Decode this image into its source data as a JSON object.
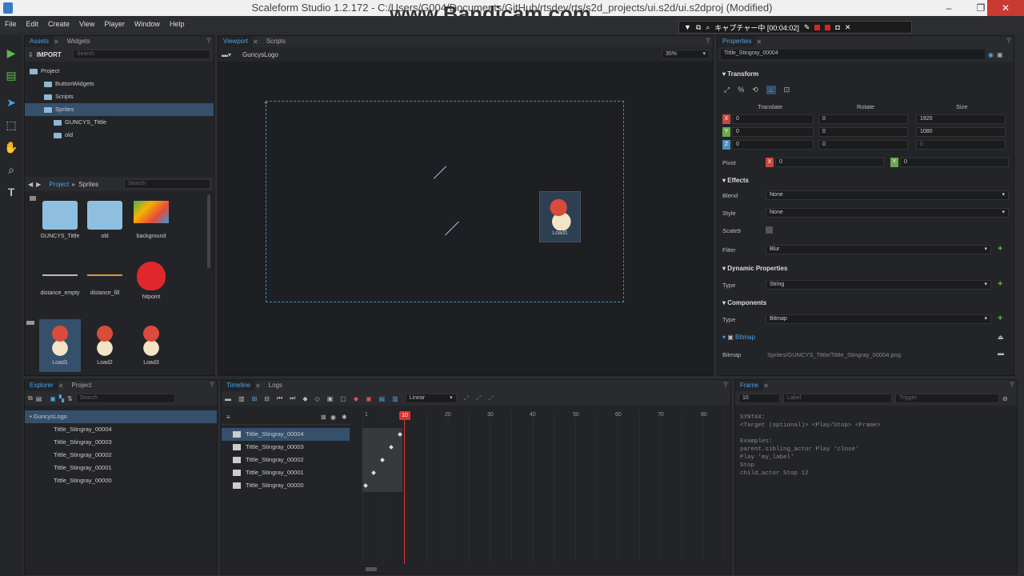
{
  "window": {
    "title": "Scaleform Studio 1.2.172 - C:/Users/G004/Documents/GitHub/rtsdev/rts/s2d_projects/ui.s2d/ui.s2dproj (Modified)"
  },
  "watermark": "www.Bandicam.com",
  "capture": {
    "label": "キャプチャー中 [00:04:02]"
  },
  "menu": [
    "File",
    "Edit",
    "Create",
    "View",
    "Player",
    "Window",
    "Help"
  ],
  "assets": {
    "tabs": [
      "Assets",
      "Widgets"
    ],
    "import_label": "IMPORT",
    "search_placeholder": "Search",
    "tree": [
      "Project",
      "ButtonWidgets",
      "Scripts",
      "Sprites",
      "GUNCYS_Tittle",
      "old"
    ],
    "breadcrumb": [
      "Project",
      "Sprites"
    ],
    "grid_search_placeholder": "Search",
    "items": [
      "GUNCYS_Tittle",
      "old",
      "background",
      "distance_empty",
      "distance_fill",
      "hitpoint",
      "Load1",
      "Load2",
      "Load3"
    ]
  },
  "viewport": {
    "tabs": [
      "Viewport",
      "Scripts"
    ],
    "scene": "GuncysLogo",
    "zoom": "35%",
    "sprite_label": "Load1"
  },
  "properties": {
    "tab": "Properties",
    "name": "Tittle_Stingray_00004",
    "transform_title": "Transform",
    "col_translate": "Translate",
    "col_rotate": "Rotate",
    "col_size": "Size",
    "axes": [
      "X",
      "Y",
      "Z"
    ],
    "translate": [
      "0",
      "0",
      "0"
    ],
    "rotate": [
      "0",
      "0",
      "0"
    ],
    "size": [
      "1920",
      "1080",
      "0"
    ],
    "pivot_label": "Pivot",
    "pivot_x": "0",
    "pivot_y": "0",
    "effects_title": "Effects",
    "blend_label": "Blend",
    "blend_value": "None",
    "style_label": "Style",
    "style_value": "None",
    "scale9_label": "Scale9",
    "filter_label": "Filter",
    "filter_value": "Blur",
    "dyn_title": "Dynamic Properties",
    "type_label": "Type",
    "dyn_type": "String",
    "components_title": "Components",
    "comp_type": "Bitmap",
    "bitmap_title": "Bitmap",
    "bitmap_label": "Bitmap",
    "bitmap_path": "Sprites/GUNCYS_Tittle/Tittle_Stingray_00004.png"
  },
  "explorer": {
    "tabs": [
      "Explorer",
      "Project"
    ],
    "search_placeholder": "Search",
    "root": "GuncysLogo",
    "children": [
      "Tittle_Stingray_00004",
      "Tittle_Stingray_00003",
      "Tittle_Stingray_00002",
      "Tittle_Stingray_00001",
      "Tittle_Stingray_00000"
    ]
  },
  "timeline": {
    "tabs": [
      "Timeline",
      "Logs"
    ],
    "ease": "Linear",
    "current_frame": "10",
    "ticks": [
      "1",
      "20",
      "30",
      "40",
      "50",
      "60",
      "70",
      "80"
    ],
    "rows": [
      "Tittle_Stingray_00004",
      "Tittle_Stingray_00003",
      "Tittle_Stingray_00002",
      "Tittle_Stingray_00001",
      "Tittle_Stingray_00000"
    ]
  },
  "frame": {
    "tab": "Frame",
    "frame_value": "10",
    "label_placeholder": "Label",
    "trigger_placeholder": "Trigger",
    "help": "SYNTAX:\n<Target (optional)> <Play/Stop> <Frame>\n\nExamples:\nparent.sibling_actor Play 'close'\nPlay 'my_label'\nStop\nchild_actor Stop 12"
  },
  "colors": {
    "accent": "#4aa3e6",
    "selection": "#35506b",
    "add": "#5dbb4c",
    "axis_x": "#c9463d",
    "axis_y": "#6aa84f",
    "axis_z": "#4a8fbf"
  }
}
